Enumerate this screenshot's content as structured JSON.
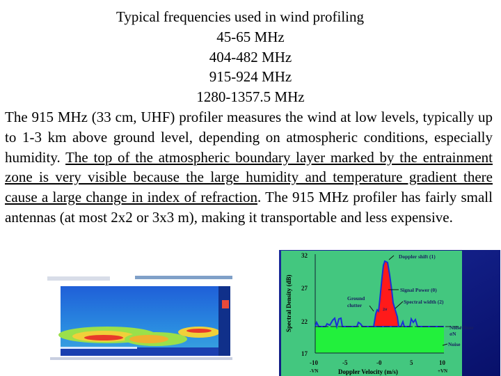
{
  "title_lines": [
    "Typical frequencies used in wind profiling",
    "45-65 MHz",
    "404-482 MHz",
    "915-924 MHz",
    "1280-1357.5 MHz"
  ],
  "paragraph": {
    "before": "The 915 MHz (33 cm, UHF) profiler measures the wind at low levels, typically up to 1-3 km above ground level, depending on atmospheric conditions, especially humidity. ",
    "underlined": "The top of the atmospheric boundary layer marked by the entrainment zone is very visible because the large humidity and temperature gradient there cause a large change in index of refraction",
    "after": ". The 915 MHz profiler has fairly small antennas (at most 2x2 or 3x3 m), making it transportable and less expensive."
  },
  "spectrum_figure": {
    "ylabel": "Spectral Density (dB)",
    "xlabel": "Doppler Velocity (m/s)",
    "y_ticks": [
      "32",
      "27",
      "22",
      "17"
    ],
    "x_ticks": [
      "-10",
      "-5",
      "-0",
      "5",
      "10"
    ],
    "x_sub_left": "-VN",
    "x_sub_right": "+VN",
    "annotations": {
      "doppler_shift": "Doppler shift (1)",
      "signal_power": "Signal Power (0)",
      "spectral_width": "Spectral width (2)",
      "ground_clutter_1": "Ground",
      "ground_clutter_2": "clutter",
      "two_sigma": "2σ",
      "noise_floor": "Noise floor",
      "sigma_n": "σN",
      "noise": "Noise"
    },
    "colors": {
      "background": "#43c77f",
      "frame": "#0d1a8c",
      "signal": "#ff1a1a",
      "noise": "#22f03c",
      "line": "#1a2fd6"
    }
  }
}
